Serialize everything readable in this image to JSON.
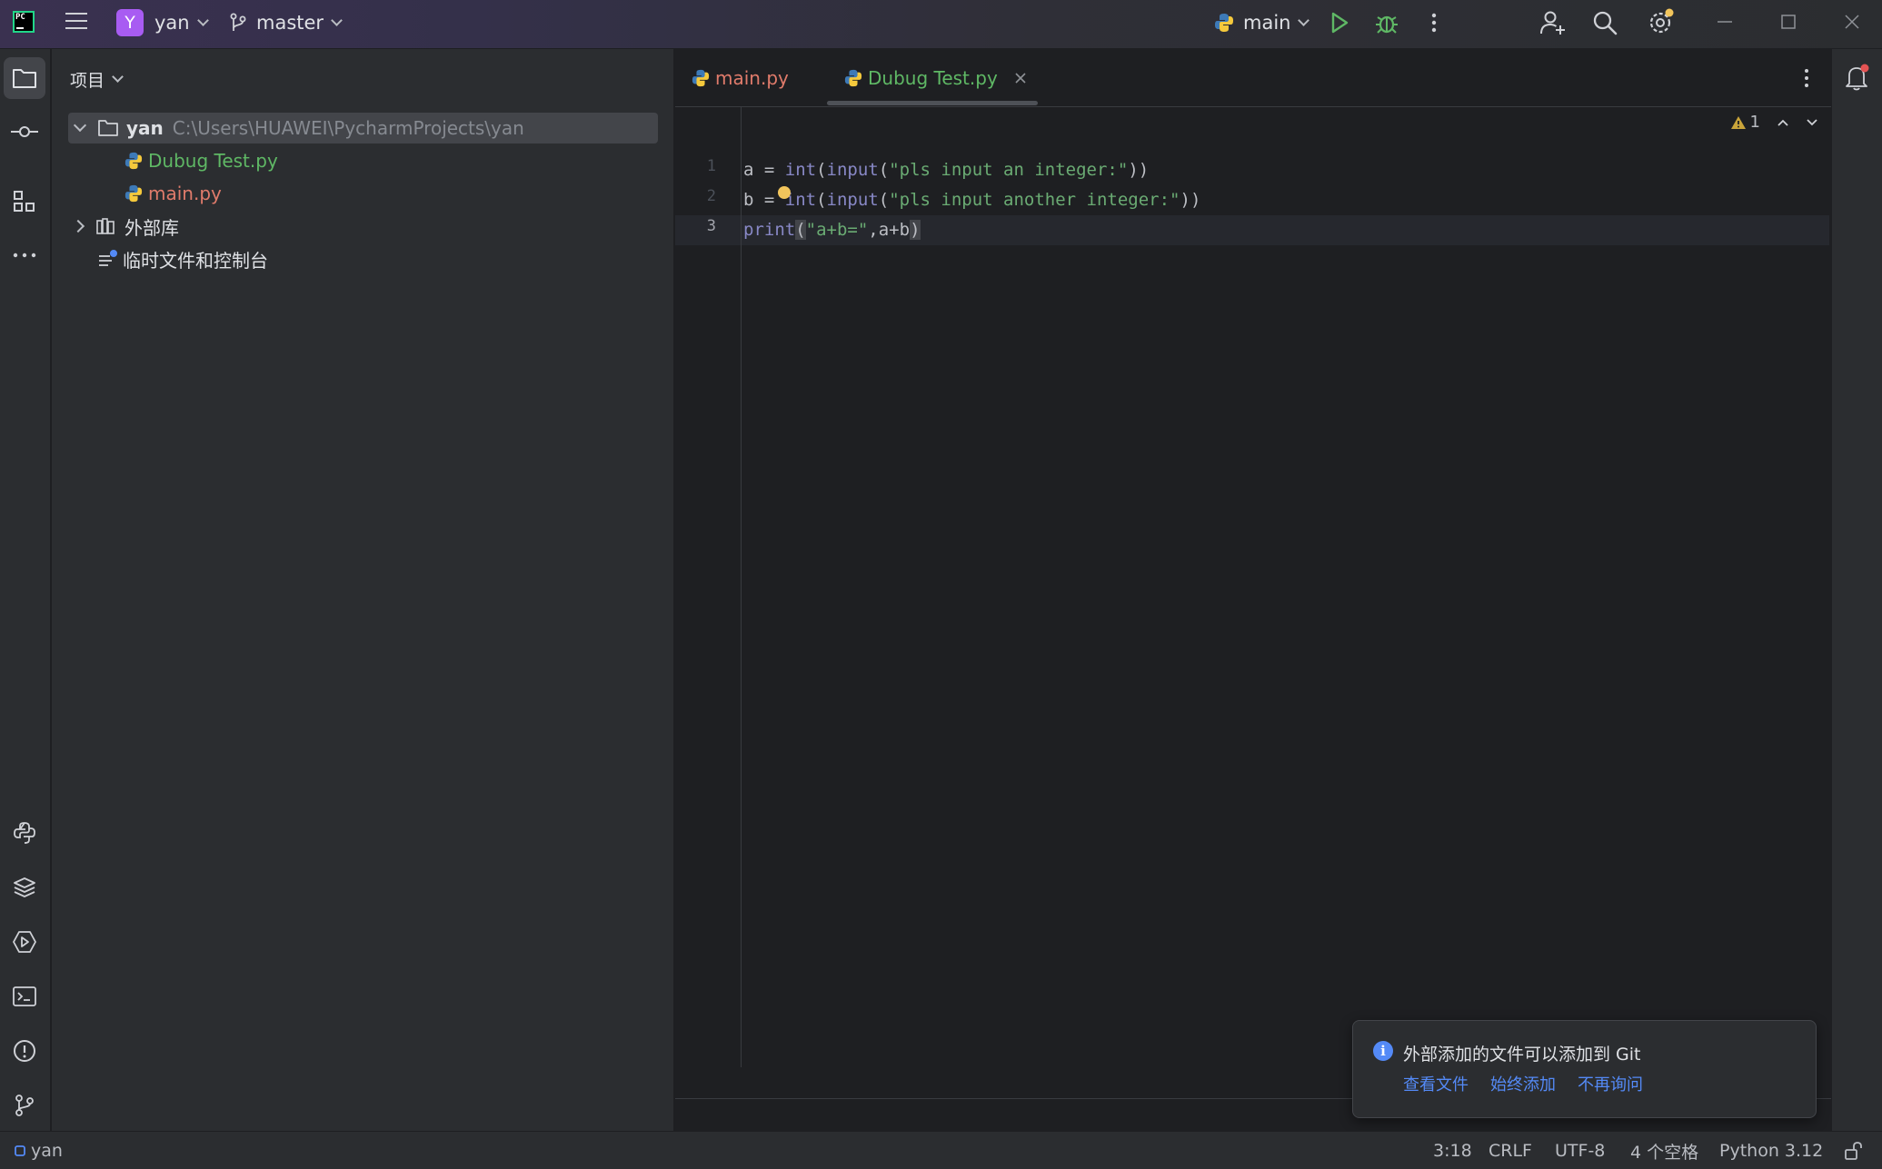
{
  "titlebar": {
    "project_badge": "Y",
    "project_name": "yan",
    "branch": "master",
    "run_config": "main",
    "icons": [
      "pycharm-logo-icon",
      "main-menu-icon",
      "branch-icon",
      "python-icon",
      "run-icon",
      "debug-icon",
      "more-icon",
      "add-user-icon",
      "search-icon",
      "settings-icon",
      "minimize-icon",
      "maximize-icon",
      "close-icon"
    ]
  },
  "left_toolbar": {
    "icons": [
      "project-icon",
      "commit-icon",
      "structure-icon",
      "more-tools-icon",
      "python-console-icon",
      "python-packages-icon",
      "services-icon",
      "terminal-icon",
      "problems-icon",
      "git-icon"
    ]
  },
  "project_panel": {
    "title": "项目",
    "tree": [
      {
        "label": "yan",
        "path": "C:\\Users\\HUAWEI\\PycharmProjects\\yan"
      },
      {
        "label": "Dubug Test.py"
      },
      {
        "label": "main.py"
      },
      {
        "label": "外部库"
      },
      {
        "label": "临时文件和控制台"
      }
    ]
  },
  "editor": {
    "tabs": [
      {
        "label": "main.py"
      },
      {
        "label": "Dubug Test.py"
      }
    ],
    "line_numbers": [
      "1",
      "2",
      "3"
    ],
    "inspection_count": "1",
    "code": {
      "l1": {
        "a": "a = ",
        "fn1": "int",
        "p1": "(",
        "fn2": "input",
        "p2": "(",
        "s": "\"pls input an integer:\"",
        "end": "))"
      },
      "l2": {
        "a": "b = ",
        "fn1": "int",
        "p1": "(",
        "fn2": "input",
        "p2": "(",
        "s": "\"pls input another integer:\"",
        "end": "))"
      },
      "l3": {
        "fn": "print",
        "open": "(",
        "s": "\"a+b=\"",
        "rest": ",a+b",
        "close": ")"
      }
    }
  },
  "notification": {
    "message": "外部添加的文件可以添加到 Git",
    "actions": [
      "查看文件",
      "始终添加",
      "不再询问"
    ]
  },
  "statusbar": {
    "project": "yan",
    "position": "3:18",
    "line_ending": "CRLF",
    "encoding": "UTF-8",
    "indent": "4 个空格",
    "interpreter": "Python 3.12"
  },
  "colors": {
    "accent_green": "#5fb865",
    "modified_file": "#e07b6b",
    "link_blue": "#548af7",
    "string_green": "#6aab73",
    "builtin_purple": "#8888c6",
    "warning_yellow": "#f2c55c"
  }
}
